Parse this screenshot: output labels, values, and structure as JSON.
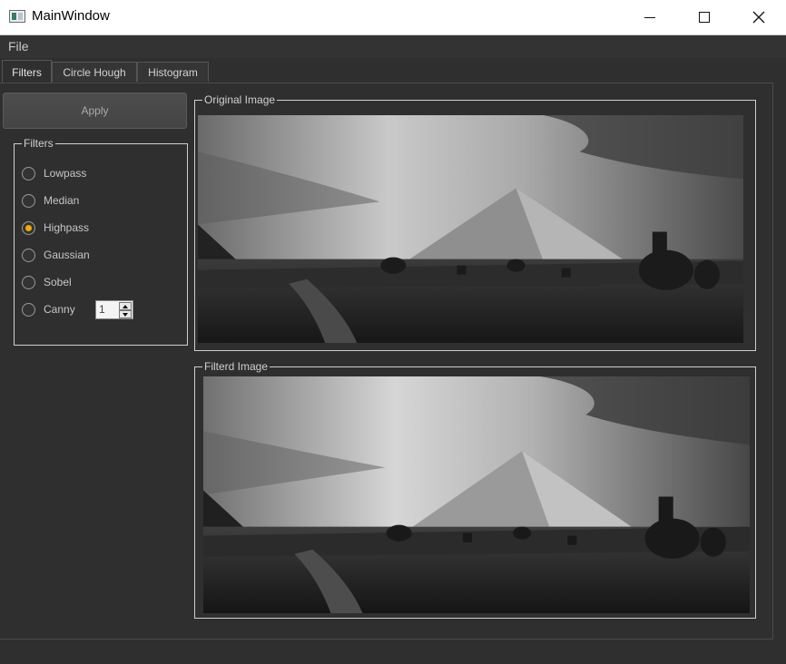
{
  "window": {
    "title": "MainWindow",
    "minimize_icon": "minimize-icon",
    "maximize_icon": "maximize-icon",
    "close_icon": "close-icon"
  },
  "menu": {
    "file_label": "File"
  },
  "tabs": [
    {
      "label": "Filters",
      "active": true
    },
    {
      "label": "Circle Hough",
      "active": false
    },
    {
      "label": "Histogram",
      "active": false
    }
  ],
  "apply_label": "Apply",
  "filters": {
    "group_title": "Filters",
    "options": [
      {
        "label": "Lowpass",
        "checked": false
      },
      {
        "label": "Median",
        "checked": false
      },
      {
        "label": "Highpass",
        "checked": true
      },
      {
        "label": "Gaussian",
        "checked": false
      },
      {
        "label": "Sobel",
        "checked": false
      },
      {
        "label": "Canny",
        "checked": false
      }
    ],
    "canny_value": "1"
  },
  "original_group_title": "Original Image",
  "filtered_group_title": "Filterd Image",
  "colors": {
    "accent": "#f4a900",
    "background": "#2f2f2f",
    "border": "#cfcfcf"
  }
}
